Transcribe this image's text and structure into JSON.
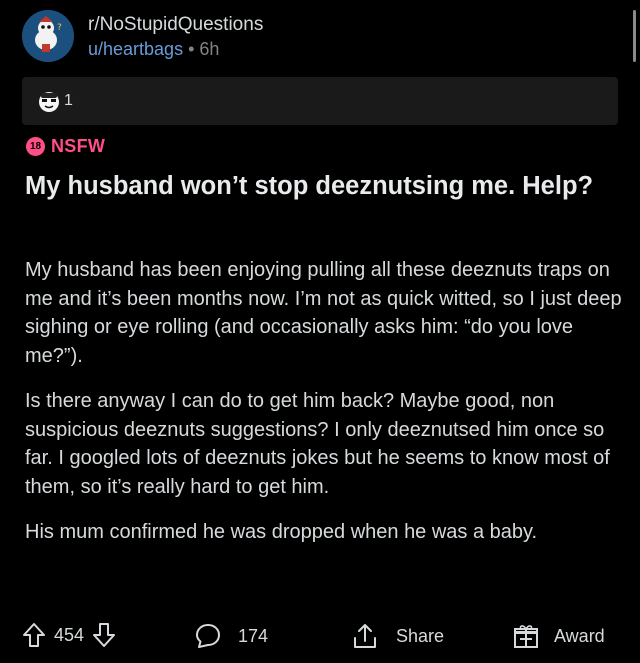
{
  "post": {
    "subreddit": "r/NoStupidQuestions",
    "username": "u/heartbags",
    "separator": "•",
    "age": "6h",
    "award_count": "1",
    "nsfw_badge": "18",
    "nsfw_label": "NSFW",
    "title": "My husband won’t stop deeznutsing me. Help?",
    "paragraphs": [
      "My husband has been enjoying pulling all these deeznuts traps on me and it’s been months now. I’m not as quick witted, so I just deep sighing or eye rolling (and occasionally asks him: “do you love me?”).",
      "Is there anyway I can do to get him back? Maybe good, non suspicious deeznuts suggestions? I only deeznutsed him once so far. I googled lots of deeznuts jokes but he seems to know most of them, so it’s really hard to get him.",
      "His mum confirmed he was dropped when he was a baby."
    ]
  },
  "actions": {
    "score": "454",
    "comments": "174",
    "share_label": "Share",
    "award_label": "Award"
  },
  "colors": {
    "background": "#000000",
    "nsfw": "#ff4f86",
    "username": "#6a9bd8",
    "award_bar": "#1a1a1b"
  }
}
